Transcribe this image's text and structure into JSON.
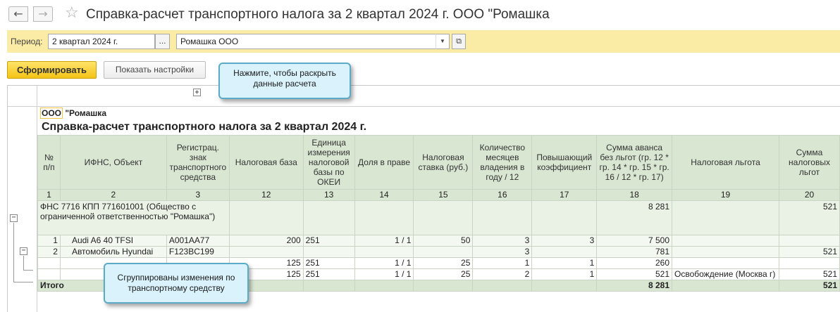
{
  "header": {
    "back_icon": "←",
    "forward_icon": "→",
    "star_icon": "☆",
    "title": "Справка-расчет транспортного налога за 2 квартал 2024 г. ООО \"Ромашка"
  },
  "period_bar": {
    "label": "Период:",
    "period_value": "2 квартал 2024 г.",
    "dots_label": "...",
    "org_value": "Ромашка ООО",
    "dropdown_icon": "▼",
    "open_icon": "⧉"
  },
  "toolbar": {
    "generate_label": "Сформировать",
    "settings_label": "Показать настройки"
  },
  "report": {
    "expand_icon": "+",
    "org_prefix": "ООО",
    "org_rest": " \"Ромашка",
    "title": "Справка-расчет транспортного налога за 2 квартал 2024 г.",
    "columns": [
      {
        "label": "№ п/п",
        "num": "1"
      },
      {
        "label": "ИФНС, Объект",
        "num": "2"
      },
      {
        "label": "Регистрац. знак транспортного средства",
        "num": "3"
      },
      {
        "label": "Налоговая база",
        "num": "12"
      },
      {
        "label": "Единица измерения налоговой базы по ОКЕИ",
        "num": "13"
      },
      {
        "label": "Доля в праве",
        "num": "14"
      },
      {
        "label": "Налоговая ставка (руб.)",
        "num": "15"
      },
      {
        "label": "Количество месяцев владения в году / 12",
        "num": "16"
      },
      {
        "label": "Повышающий коэффициент",
        "num": "17"
      },
      {
        "label": "Сумма аванса без льгот (гр. 12 * гр. 14 * гр. 15 * гр. 16 / 12 * гр. 17)",
        "num": "18"
      },
      {
        "label": "Налоговая льгота",
        "num": "19"
      },
      {
        "label": "Сумма налоговых льгот",
        "num": "20"
      }
    ],
    "group": {
      "name": "ФНС 7716 КПП 771601001 (Общество с ограниченной ответственностью \"Ромашка\")",
      "sum18": "8 281",
      "sum20": "521"
    },
    "rows": [
      {
        "n": "1",
        "object": "Audi A6 40 TFSI",
        "reg": "A001AA77",
        "base": "200",
        "okei": "251",
        "share": "1 / 1",
        "rate": "50",
        "months": "3",
        "coef": "3",
        "sum18": "7 500",
        "benefit": "",
        "sum20": ""
      },
      {
        "n": "2",
        "object": "Автомобиль Hyundai",
        "reg": "F123BC199",
        "base": "",
        "okei": "",
        "share": "",
        "rate": "",
        "months": "3",
        "coef": "",
        "sum18": "781",
        "benefit": "",
        "sum20": "521"
      },
      {
        "n": "",
        "object": "",
        "reg": "",
        "base": "125",
        "okei": "251",
        "share": "1 / 1",
        "rate": "25",
        "months": "1",
        "coef": "1",
        "sum18": "260",
        "benefit": "",
        "sum20": ""
      },
      {
        "n": "",
        "object": "",
        "reg": "",
        "base": "125",
        "okei": "251",
        "share": "1 / 1",
        "rate": "25",
        "months": "2",
        "coef": "1",
        "sum18": "521",
        "benefit": "Освобождение (Москва г)",
        "sum20": "521"
      }
    ],
    "total": {
      "label": "Итого",
      "sum18": "8 281",
      "sum20": "521"
    },
    "collapse_icon": "−"
  },
  "callouts": {
    "expand_hint": "Нажмите, чтобы раскрыть данные расчета",
    "group_hint": "Сгруппированы изменения по транспортному средству"
  }
}
